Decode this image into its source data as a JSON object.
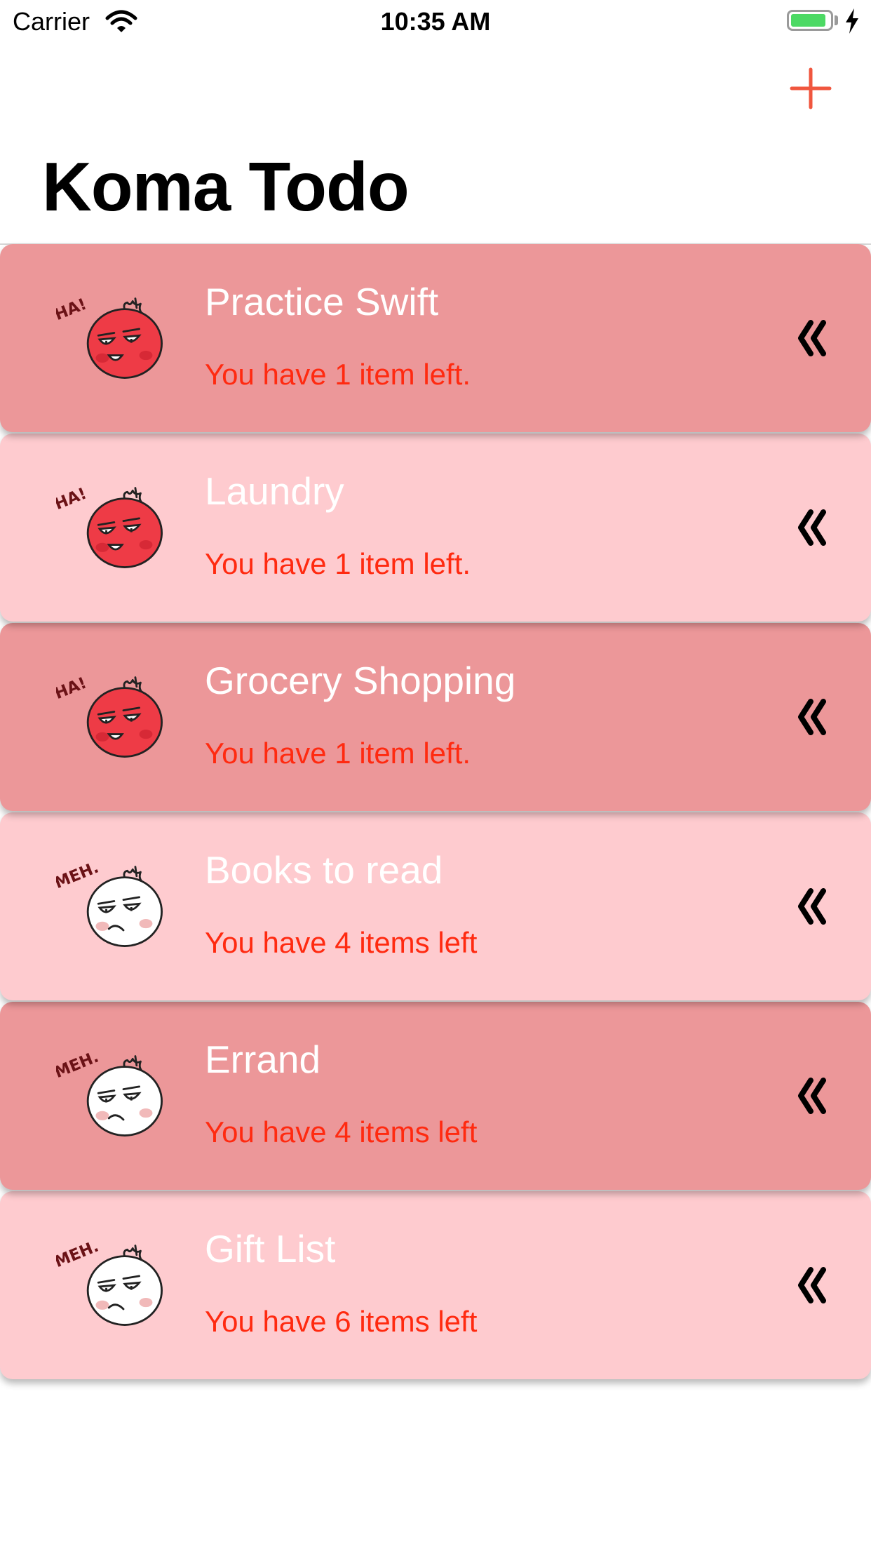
{
  "status_bar": {
    "carrier": "Carrier",
    "time": "10:35 AM",
    "battery_level": 0.9,
    "battery_color": "#4cd964"
  },
  "nav": {
    "title": "Koma Todo",
    "add_icon": "plus-icon",
    "accent_color": "#f0563e"
  },
  "lists": [
    {
      "title": "Practice Swift",
      "subtitle": "You have 1 item left.",
      "mood": "ha",
      "mood_label": "HA!",
      "style": "dark"
    },
    {
      "title": "Laundry",
      "subtitle": "You have 1 item left.",
      "mood": "ha",
      "mood_label": "HA!",
      "style": "light"
    },
    {
      "title": "Grocery Shopping",
      "subtitle": "You have 1 item left.",
      "mood": "ha",
      "mood_label": "HA!",
      "style": "dark"
    },
    {
      "title": "Books to read",
      "subtitle": "You have 4 items left",
      "mood": "meh",
      "mood_label": "MEH.",
      "style": "light"
    },
    {
      "title": "Errand",
      "subtitle": "You have 4 items left",
      "mood": "meh",
      "mood_label": "MEH.",
      "style": "dark"
    },
    {
      "title": "Gift List",
      "subtitle": "You have 6 items left",
      "mood": "meh",
      "mood_label": "MEH.",
      "style": "light"
    }
  ],
  "colors": {
    "card_dark": "#ec9799",
    "card_light": "#fecbcf",
    "subtitle": "#ff2a10",
    "title": "#ffffff"
  }
}
